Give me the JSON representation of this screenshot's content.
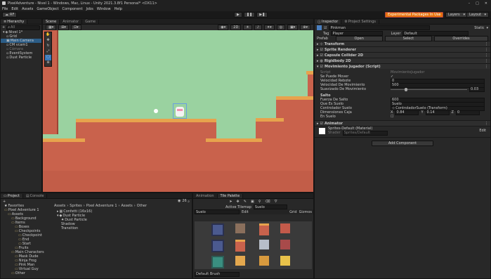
{
  "window": {
    "title": "PixelAdventure - Nivel 1 - Windows, Mac, Linux - Unity 2021.3.8f1 Personal* <DX11>"
  },
  "menu": [
    "File",
    "Edit",
    "Assets",
    "GameObject",
    "Component",
    "Jobs",
    "Window",
    "Help"
  ],
  "toolbar": {
    "account": "RF",
    "experimental": "Experimental Packages In Use",
    "layers": "Layers",
    "layout": "Layout"
  },
  "hierarchy": {
    "tab": "Hierarchy",
    "search_placeholder": "All",
    "items": [
      "Nivel 1*",
      "Grid",
      "Main Camera",
      "CM vcam1",
      "Cámara",
      "EventSystem",
      "Dust Particle"
    ]
  },
  "scene": {
    "tabs": [
      "Scene",
      "Animator",
      "Game"
    ],
    "gizmo_2d": "2D"
  },
  "inspector": {
    "tabs": [
      "Inspector",
      "Project Settings"
    ],
    "object_name": "Pinkman",
    "static_label": "Static",
    "tag_label": "Tag",
    "tag_value": "Player",
    "layer_label": "Layer",
    "layer_value": "Default",
    "prefab_label": "Prefab",
    "prefab_open": "Open",
    "prefab_select": "Select",
    "prefab_overrides": "Overrides",
    "components": [
      "Transform",
      "Sprite Renderer",
      "Capsule Collider 2D",
      "Rigidbody 2D",
      "Movimiento Jugador (Script)"
    ],
    "script_label": "Script",
    "script_value": "MovimientoJugador",
    "fields": [
      {
        "label": "Se Puede Mover",
        "value": "✓"
      },
      {
        "label": "Velocidad Rebote",
        "value": "0"
      },
      {
        "label": "Velocidad De Movimiento",
        "value": "500"
      },
      {
        "label": "Suavizado De Movimiento",
        "value": "0.03"
      }
    ],
    "salto_header": "Salto",
    "salto_fields": [
      {
        "label": "Fuerza De Salto",
        "value": "600"
      },
      {
        "label": "Que Es Suelo",
        "value": "Suelo"
      },
      {
        "label": "Controlador Suelo",
        "value": "ControladorSuelo (Transform)"
      },
      {
        "label": "Dimensiones Caja",
        "x": "0.84",
        "y": "0.14",
        "z": "0"
      },
      {
        "label": "En Suelo",
        "value": ""
      }
    ],
    "animator": "Animator",
    "material_name": "Sprites-Default (Material)",
    "shader_label": "Shader",
    "shader_value": "Sprites/Default",
    "add_component": "Add Component"
  },
  "project": {
    "tabs": [
      "Project",
      "Console"
    ],
    "tree": [
      {
        "label": "Favorites",
        "indent": 1
      },
      {
        "label": "Pixel Adventure 1",
        "indent": 1
      },
      {
        "label": "Assets",
        "indent": 2
      },
      {
        "label": "Background",
        "indent": 3
      },
      {
        "label": "Items",
        "indent": 3
      },
      {
        "label": "Boxes",
        "indent": 4
      },
      {
        "label": "Checkpoints",
        "indent": 4
      },
      {
        "label": "Checkpoint",
        "indent": 5
      },
      {
        "label": "End",
        "indent": 5
      },
      {
        "label": "Start",
        "indent": 5
      },
      {
        "label": "Fruits",
        "indent": 4
      },
      {
        "label": "Main Characters",
        "indent": 3
      },
      {
        "label": "Mask Dude",
        "indent": 4
      },
      {
        "label": "Ninja Frog",
        "indent": 4
      },
      {
        "label": "Pink Man",
        "indent": 4
      },
      {
        "label": "Virtual Guy",
        "indent": 4
      },
      {
        "label": "Other",
        "indent": 3
      }
    ],
    "breadcrumb": [
      "Assets",
      "Sprites",
      "Pixel Adventure 1",
      "Assets",
      "Other"
    ],
    "files": [
      "Confetti (16x16)",
      "Dust Particle",
      "Dust Particle",
      "Shadow",
      "Transition"
    ],
    "count": "26"
  },
  "palette": {
    "tabs": [
      "Animation",
      "Tile Palette"
    ],
    "active_tilemap_label": "Active Tilemap",
    "active_tilemap_value": "Suelo",
    "palette_name": "Suelo",
    "edit_label": "Edit",
    "grid_label": "Grid",
    "gizmos_label": "Gizmos",
    "brush": "Default Brush"
  },
  "colors": {
    "accent": "#3a79bb",
    "bg_green": "#9ad2a0",
    "ground": "#c9624c",
    "orange": "#e7a34d",
    "experimental": "#e8710a"
  }
}
